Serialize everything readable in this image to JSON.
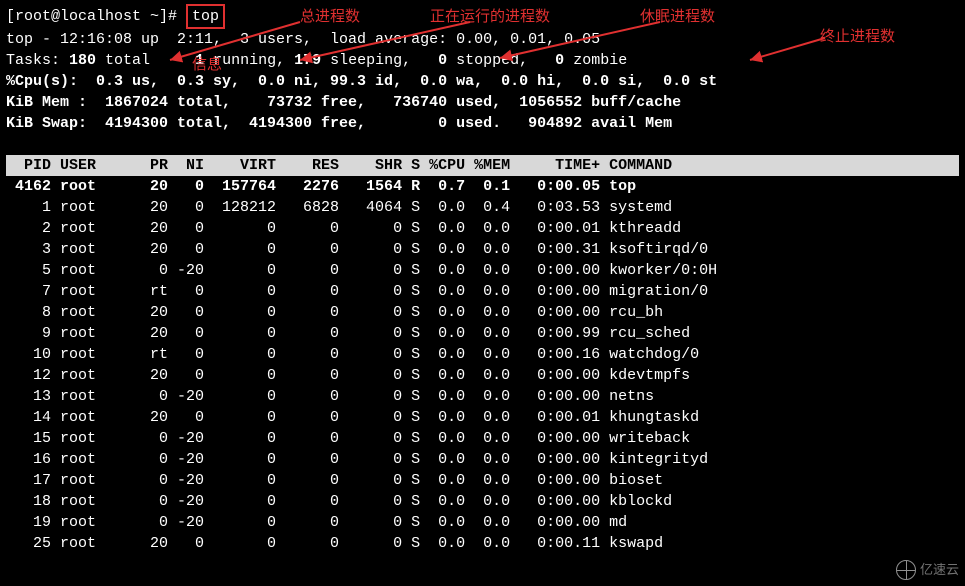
{
  "prompt_prefix": "[root@localhost ~]# ",
  "prompt_cmd": "top",
  "summary": {
    "line1_a": "top - 12:16:08 up  2:11,  3 users,  load average: 0.00, 0.01, 0.05",
    "tasks_label": "Tasks:",
    "tasks_total": "180",
    "tasks_total_lbl": " total",
    "tasks_mid1": "     ",
    "tasks_running": "1",
    "tasks_running_lbl": " running,",
    "tasks_sleeping": " 179",
    "tasks_sleeping_lbl": " sleeping,",
    "tasks_stopped": "   0",
    "tasks_stopped_lbl": " stopped,",
    "tasks_zombie": "   0",
    "tasks_zombie_lbl": " zombie",
    "cpu": "%Cpu(s):  0.3 us,  0.3 sy,  0.0 ni, 99.3 id,  0.0 wa,  0.0 hi,  0.0 si,  0.0 st",
    "mem": "KiB Mem :  1867024 total,    73732 free,   736740 used,  1056552 buff/cache",
    "swap": "KiB Swap:  4194300 total,  4194300 free,        0 used.   904892 avail Mem"
  },
  "annotations": {
    "a1": "总进程数",
    "a2": "正在运行的进程数",
    "a3": "休眠进程数",
    "a4": "终止进程数",
    "a5": "信息"
  },
  "header_row": "  PID USER      PR  NI    VIRT    RES    SHR S %CPU %MEM     TIME+ COMMAND        ",
  "processes": [
    {
      "pid": " 4162",
      "user": "root",
      "pr": "20",
      "ni": "  0",
      "virt": " 157764",
      "res": "  2276",
      "shr": "  1564",
      "s": "R",
      "cpu": " 0.7",
      "mem": " 0.1",
      "time": "  0:00.05",
      "cmd": "top"
    },
    {
      "pid": "    1",
      "user": "root",
      "pr": "20",
      "ni": "  0",
      "virt": " 128212",
      "res": "  6828",
      "shr": "  4064",
      "s": "S",
      "cpu": " 0.0",
      "mem": " 0.4",
      "time": "  0:03.53",
      "cmd": "systemd"
    },
    {
      "pid": "    2",
      "user": "root",
      "pr": "20",
      "ni": "  0",
      "virt": "      0",
      "res": "     0",
      "shr": "     0",
      "s": "S",
      "cpu": " 0.0",
      "mem": " 0.0",
      "time": "  0:00.01",
      "cmd": "kthreadd"
    },
    {
      "pid": "    3",
      "user": "root",
      "pr": "20",
      "ni": "  0",
      "virt": "      0",
      "res": "     0",
      "shr": "     0",
      "s": "S",
      "cpu": " 0.0",
      "mem": " 0.0",
      "time": "  0:00.31",
      "cmd": "ksoftirqd/0"
    },
    {
      "pid": "    5",
      "user": "root",
      "pr": " 0",
      "ni": "-20",
      "virt": "      0",
      "res": "     0",
      "shr": "     0",
      "s": "S",
      "cpu": " 0.0",
      "mem": " 0.0",
      "time": "  0:00.00",
      "cmd": "kworker/0:0H"
    },
    {
      "pid": "    7",
      "user": "root",
      "pr": "rt",
      "ni": "  0",
      "virt": "      0",
      "res": "     0",
      "shr": "     0",
      "s": "S",
      "cpu": " 0.0",
      "mem": " 0.0",
      "time": "  0:00.00",
      "cmd": "migration/0"
    },
    {
      "pid": "    8",
      "user": "root",
      "pr": "20",
      "ni": "  0",
      "virt": "      0",
      "res": "     0",
      "shr": "     0",
      "s": "S",
      "cpu": " 0.0",
      "mem": " 0.0",
      "time": "  0:00.00",
      "cmd": "rcu_bh"
    },
    {
      "pid": "    9",
      "user": "root",
      "pr": "20",
      "ni": "  0",
      "virt": "      0",
      "res": "     0",
      "shr": "     0",
      "s": "S",
      "cpu": " 0.0",
      "mem": " 0.0",
      "time": "  0:00.99",
      "cmd": "rcu_sched"
    },
    {
      "pid": "   10",
      "user": "root",
      "pr": "rt",
      "ni": "  0",
      "virt": "      0",
      "res": "     0",
      "shr": "     0",
      "s": "S",
      "cpu": " 0.0",
      "mem": " 0.0",
      "time": "  0:00.16",
      "cmd": "watchdog/0"
    },
    {
      "pid": "   12",
      "user": "root",
      "pr": "20",
      "ni": "  0",
      "virt": "      0",
      "res": "     0",
      "shr": "     0",
      "s": "S",
      "cpu": " 0.0",
      "mem": " 0.0",
      "time": "  0:00.00",
      "cmd": "kdevtmpfs"
    },
    {
      "pid": "   13",
      "user": "root",
      "pr": " 0",
      "ni": "-20",
      "virt": "      0",
      "res": "     0",
      "shr": "     0",
      "s": "S",
      "cpu": " 0.0",
      "mem": " 0.0",
      "time": "  0:00.00",
      "cmd": "netns"
    },
    {
      "pid": "   14",
      "user": "root",
      "pr": "20",
      "ni": "  0",
      "virt": "      0",
      "res": "     0",
      "shr": "     0",
      "s": "S",
      "cpu": " 0.0",
      "mem": " 0.0",
      "time": "  0:00.01",
      "cmd": "khungtaskd"
    },
    {
      "pid": "   15",
      "user": "root",
      "pr": " 0",
      "ni": "-20",
      "virt": "      0",
      "res": "     0",
      "shr": "     0",
      "s": "S",
      "cpu": " 0.0",
      "mem": " 0.0",
      "time": "  0:00.00",
      "cmd": "writeback"
    },
    {
      "pid": "   16",
      "user": "root",
      "pr": " 0",
      "ni": "-20",
      "virt": "      0",
      "res": "     0",
      "shr": "     0",
      "s": "S",
      "cpu": " 0.0",
      "mem": " 0.0",
      "time": "  0:00.00",
      "cmd": "kintegrityd"
    },
    {
      "pid": "   17",
      "user": "root",
      "pr": " 0",
      "ni": "-20",
      "virt": "      0",
      "res": "     0",
      "shr": "     0",
      "s": "S",
      "cpu": " 0.0",
      "mem": " 0.0",
      "time": "  0:00.00",
      "cmd": "bioset"
    },
    {
      "pid": "   18",
      "user": "root",
      "pr": " 0",
      "ni": "-20",
      "virt": "      0",
      "res": "     0",
      "shr": "     0",
      "s": "S",
      "cpu": " 0.0",
      "mem": " 0.0",
      "time": "  0:00.00",
      "cmd": "kblockd"
    },
    {
      "pid": "   19",
      "user": "root",
      "pr": " 0",
      "ni": "-20",
      "virt": "      0",
      "res": "     0",
      "shr": "     0",
      "s": "S",
      "cpu": " 0.0",
      "mem": " 0.0",
      "time": "  0:00.00",
      "cmd": "md"
    },
    {
      "pid": "   25",
      "user": "root",
      "pr": "20",
      "ni": "  0",
      "virt": "      0",
      "res": "     0",
      "shr": "     0",
      "s": "S",
      "cpu": " 0.0",
      "mem": " 0.0",
      "time": "  0:00.11",
      "cmd": "kswapd"
    }
  ],
  "watermark_text": "亿速云"
}
